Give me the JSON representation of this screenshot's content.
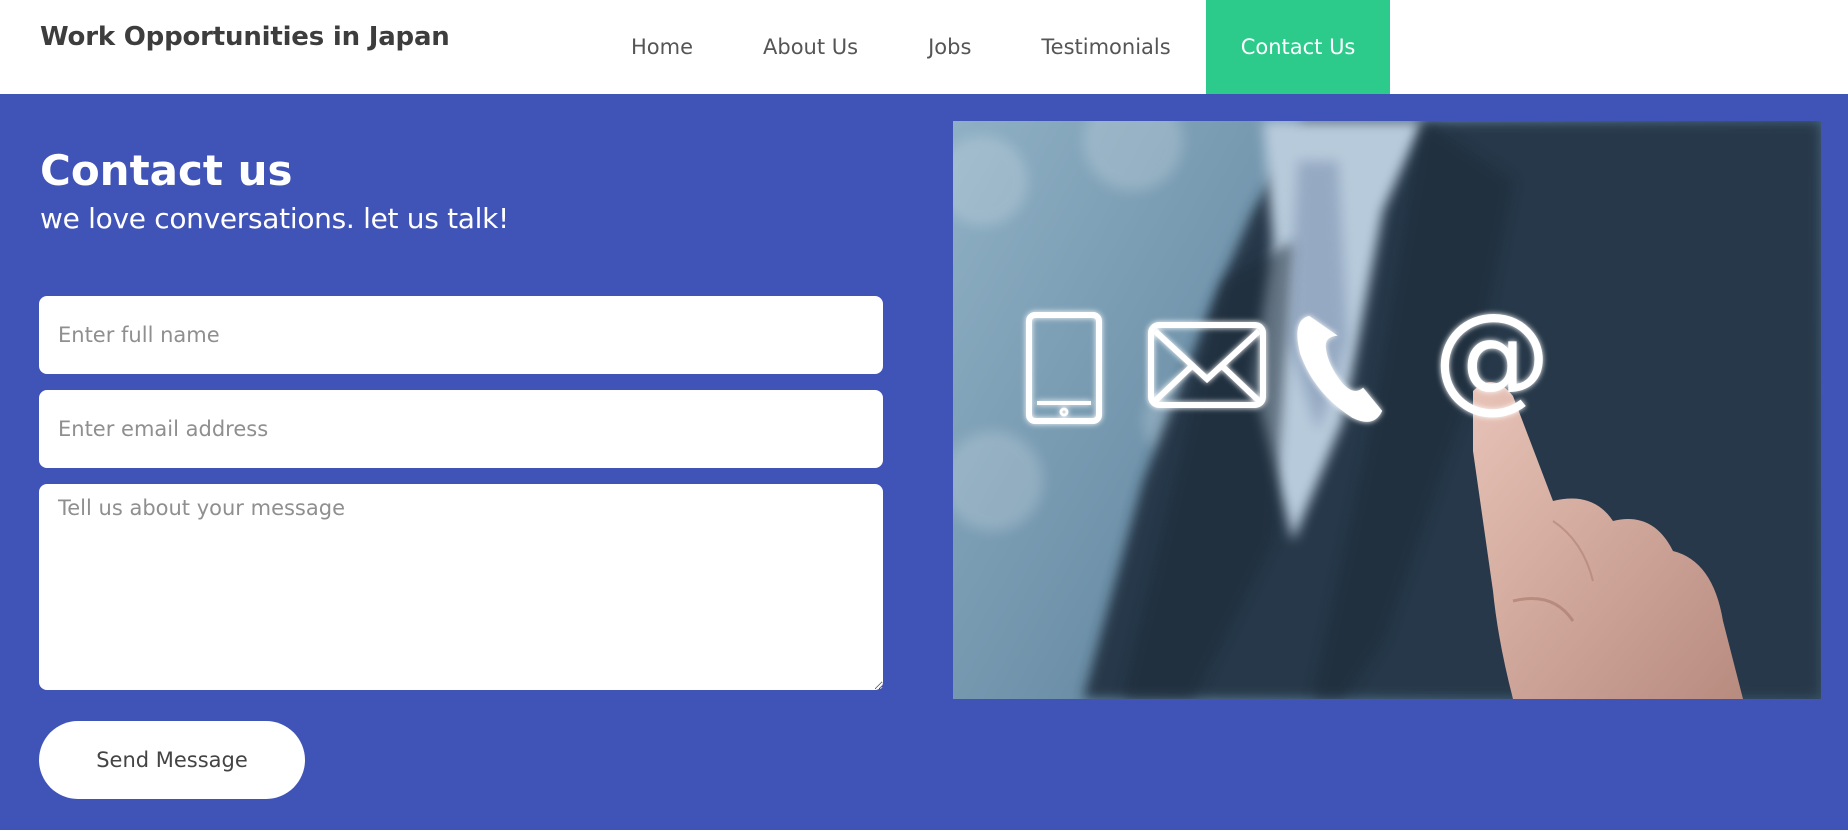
{
  "header": {
    "brand": "Work Opportunities in Japan",
    "nav": [
      {
        "label": "Home",
        "active": false
      },
      {
        "label": "About Us",
        "active": false
      },
      {
        "label": "Jobs",
        "active": false
      },
      {
        "label": "Testimonials",
        "active": false
      },
      {
        "label": "Contact Us",
        "active": true
      }
    ],
    "active_color": "#2ccb8b"
  },
  "contact": {
    "title": "Contact us",
    "subtitle": "we love conversations. let us talk!",
    "background_color": "#4053b7",
    "form": {
      "name_placeholder": "Enter full name",
      "email_placeholder": "Enter email address",
      "message_placeholder": "Tell us about your message",
      "submit_label": "Send Message"
    }
  },
  "photo": {
    "icons": [
      "smartphone-icon",
      "envelope-icon",
      "phone-handset-icon",
      "at-sign-icon"
    ],
    "at_symbol": "@"
  }
}
